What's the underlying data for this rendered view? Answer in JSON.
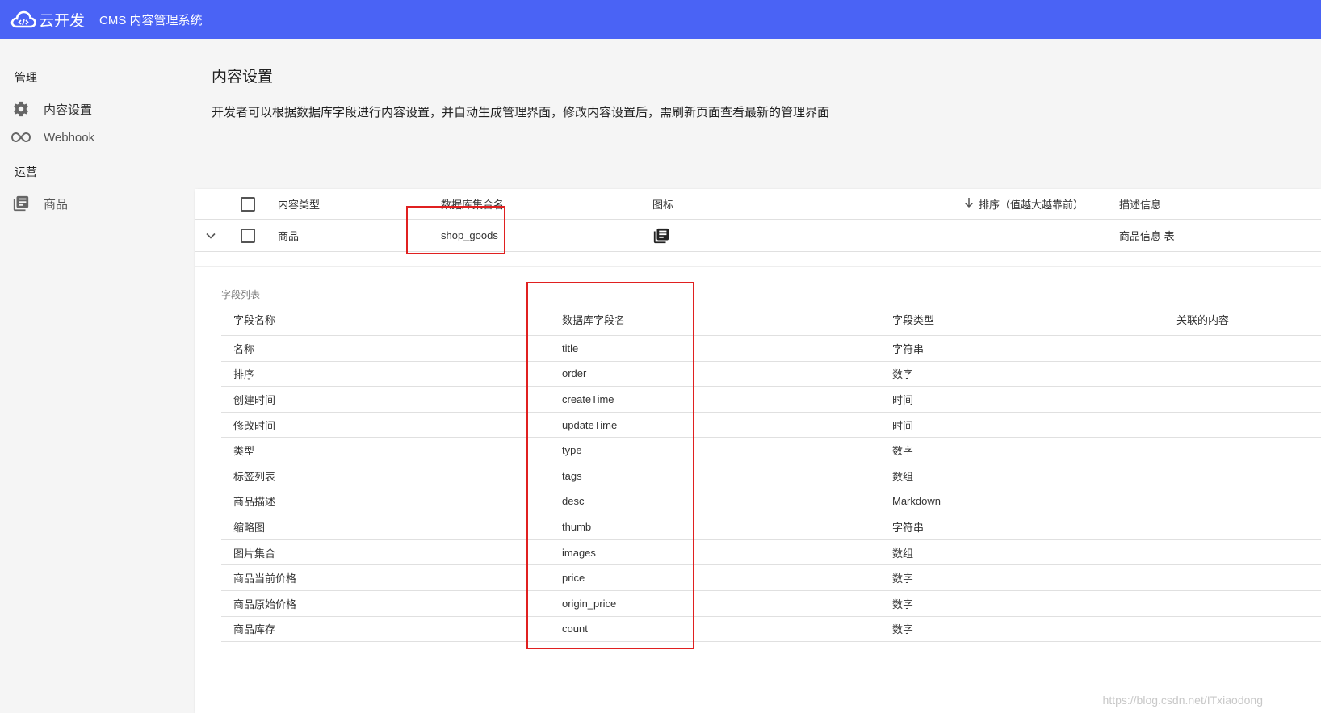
{
  "header": {
    "logo_text": "云开发",
    "app_title": "CMS 内容管理系统",
    "colors": {
      "bar": "#4a63f5"
    }
  },
  "sidebar": {
    "sections": [
      {
        "title": "管理",
        "items": [
          {
            "label": "内容设置",
            "icon": "gear-icon"
          },
          {
            "label": "Webhook",
            "icon": "link-icon"
          }
        ]
      },
      {
        "title": "运营",
        "items": [
          {
            "label": "商品",
            "icon": "library-books-icon"
          }
        ]
      }
    ]
  },
  "page": {
    "title": "内容设置",
    "description": "开发者可以根据数据库字段进行内容设置，并自动生成管理界面，修改内容设置后，需刷新页面查看最新的管理界面"
  },
  "table": {
    "columns": [
      "内容类型",
      "数据库集合名",
      "图标",
      "排序（值越大越靠前）",
      "描述信息"
    ],
    "sort_icon": "arrow-down-icon",
    "rows": [
      {
        "type": "商品",
        "collection": "shop_goods",
        "icon": "library-books-icon",
        "description": "商品信息 表"
      }
    ]
  },
  "fields": {
    "caption": "字段列表",
    "columns": [
      "字段名称",
      "数据库字段名",
      "字段类型",
      "关联的内容"
    ],
    "rows": [
      {
        "name": "名称",
        "key": "title",
        "type": "字符串"
      },
      {
        "name": "排序",
        "key": "order",
        "type": "数字"
      },
      {
        "name": "创建时间",
        "key": "createTime",
        "type": "时间"
      },
      {
        "name": "修改时间",
        "key": "updateTime",
        "type": "时间"
      },
      {
        "name": "类型",
        "key": "type",
        "type": "数字"
      },
      {
        "name": "标签列表",
        "key": "tags",
        "type": "数组"
      },
      {
        "name": "商品描述",
        "key": "desc",
        "type": "Markdown"
      },
      {
        "name": "缩略图",
        "key": "thumb",
        "type": "字符串"
      },
      {
        "name": "图片集合",
        "key": "images",
        "type": "数组"
      },
      {
        "name": "商品当前价格",
        "key": "price",
        "type": "数字"
      },
      {
        "name": "商品原始价格",
        "key": "origin_price",
        "type": "数字"
      },
      {
        "name": "商品库存",
        "key": "count",
        "type": "数字"
      }
    ]
  },
  "watermark": "https://blog.csdn.net/ITxiaodong",
  "annotation_color": "#e02020"
}
